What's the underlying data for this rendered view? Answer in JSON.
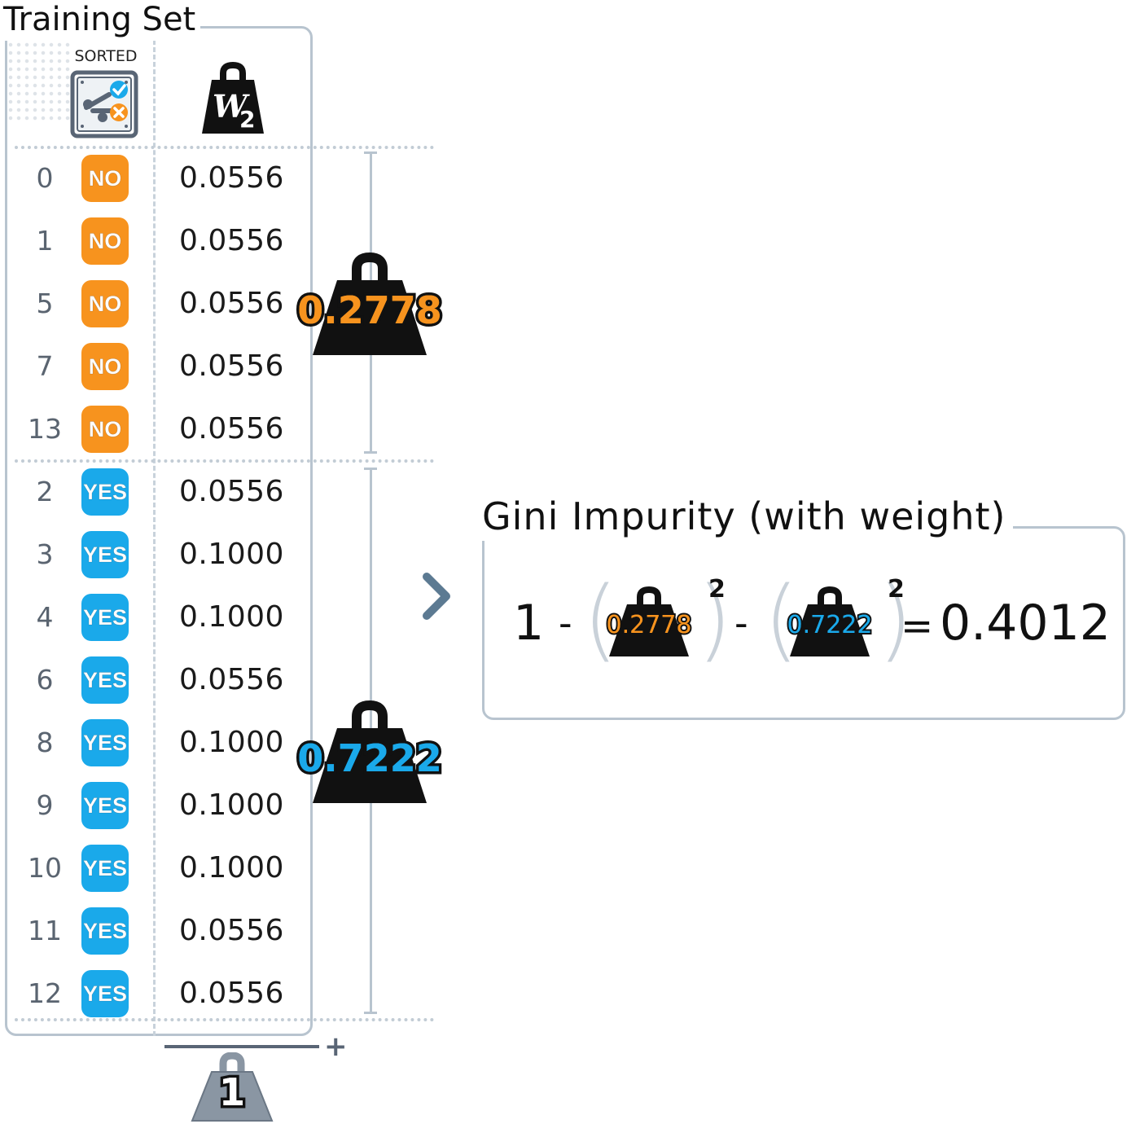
{
  "title": "Training Set",
  "table": {
    "sorted_label": "SORTED",
    "weight_icon": "w2-weight-icon",
    "weight_icon_text": {
      "letter": "W",
      "subscript": "2"
    },
    "rows": [
      {
        "index": "0",
        "label": "NO",
        "weight": "0.0556"
      },
      {
        "index": "1",
        "label": "NO",
        "weight": "0.0556"
      },
      {
        "index": "5",
        "label": "NO",
        "weight": "0.0556"
      },
      {
        "index": "7",
        "label": "NO",
        "weight": "0.0556"
      },
      {
        "index": "13",
        "label": "NO",
        "weight": "0.0556"
      },
      {
        "index": "2",
        "label": "YES",
        "weight": "0.0556"
      },
      {
        "index": "3",
        "label": "YES",
        "weight": "0.1000"
      },
      {
        "index": "4",
        "label": "YES",
        "weight": "0.1000"
      },
      {
        "index": "6",
        "label": "YES",
        "weight": "0.0556"
      },
      {
        "index": "8",
        "label": "YES",
        "weight": "0.1000"
      },
      {
        "index": "9",
        "label": "YES",
        "weight": "0.1000"
      },
      {
        "index": "10",
        "label": "YES",
        "weight": "0.1000"
      },
      {
        "index": "11",
        "label": "YES",
        "weight": "0.0556"
      },
      {
        "index": "12",
        "label": "YES",
        "weight": "0.0556"
      }
    ]
  },
  "groups": {
    "no_total": "0.2778",
    "yes_total": "0.7222",
    "grand_total": "1"
  },
  "gini": {
    "title": "Gini Impurity (with weight)",
    "one": "1",
    "minus": "-",
    "p_no": "0.2778",
    "p_yes": "0.7222",
    "exponent": "2",
    "equals": "=",
    "result": "0.4012"
  },
  "colors": {
    "no": "#f7931e",
    "yes": "#1aa9ea",
    "weight_dark": "#111111",
    "frame": "#b8c4cf",
    "total_weight": "#8a96a3"
  },
  "icons": [
    "sort-classify-icon",
    "w2-weight-icon",
    "kettlebell-weight-icon",
    "chevron-right-icon",
    "plus-icon"
  ]
}
